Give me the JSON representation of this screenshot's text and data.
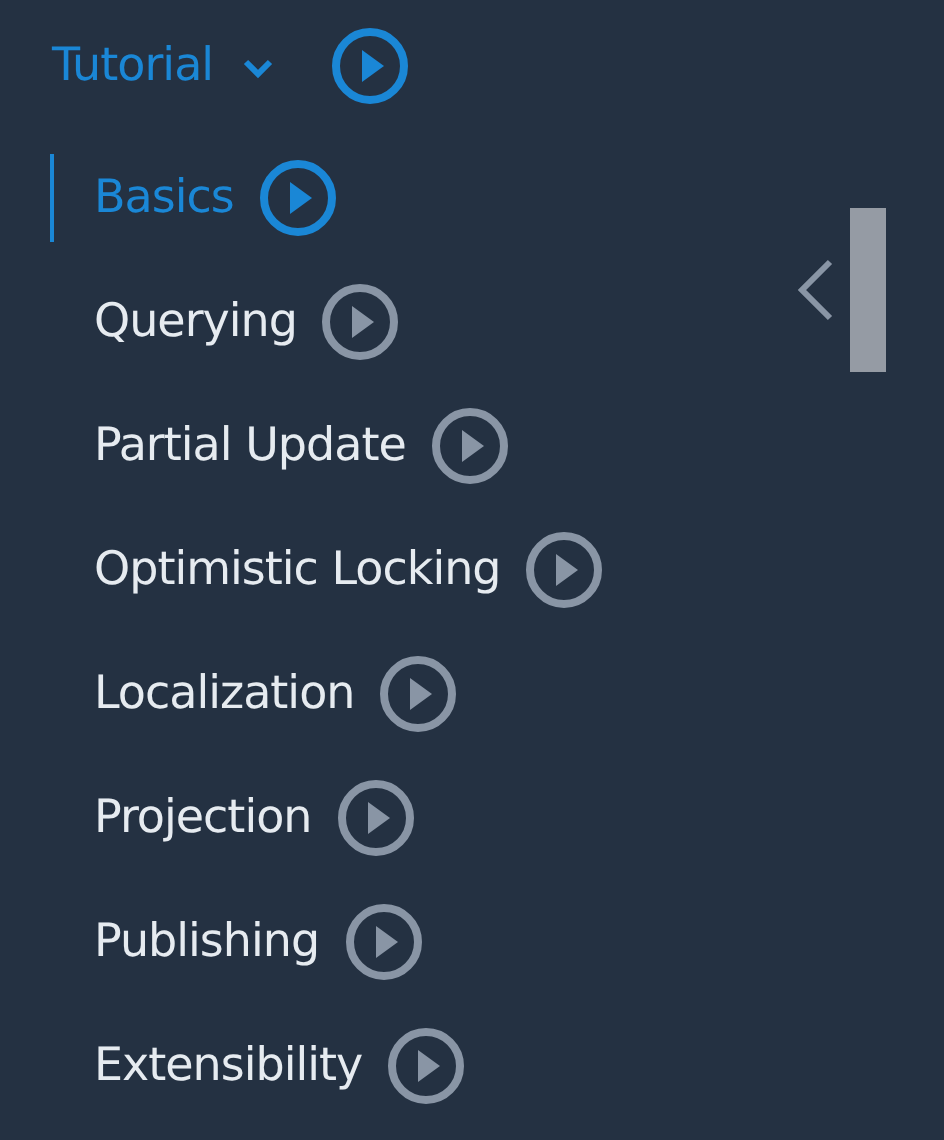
{
  "section": {
    "title": "Tutorial",
    "expanded": true
  },
  "items": [
    {
      "label": "Basics",
      "selected": true
    },
    {
      "label": "Querying",
      "selected": false
    },
    {
      "label": "Partial Update",
      "selected": false
    },
    {
      "label": "Optimistic Locking",
      "selected": false
    },
    {
      "label": "Localization",
      "selected": false
    },
    {
      "label": "Projection",
      "selected": false
    },
    {
      "label": "Publishing",
      "selected": false
    },
    {
      "label": "Extensibility",
      "selected": false
    }
  ]
}
